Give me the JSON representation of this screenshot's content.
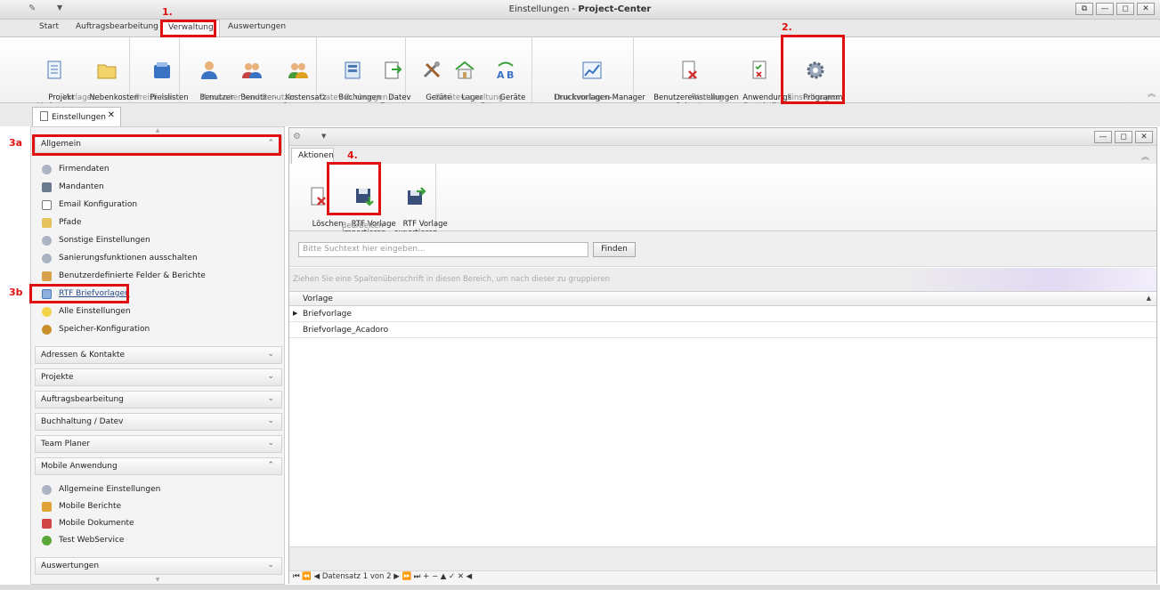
{
  "window": {
    "title_left": "Einstellungen - ",
    "title_bold": "Project-Center",
    "btn_restore": "⧉",
    "btn_minimize": "—",
    "btn_maximize": "◻",
    "btn_close": "✕"
  },
  "ribbon_tabs": [
    "Start",
    "Auftragsbearbeitung",
    "Verwaltung",
    "Auswertungen"
  ],
  "ribbon": {
    "buttons": {
      "projekt_vorlagen": "Projekt\nVorlagen",
      "nebenkosten": "Nebenkosten",
      "preislisten": "Preislisten",
      "benutzer": "Benutzer",
      "benutzergruppen": "Benutzer-\ngruppen",
      "kostensatz_gruppen": "Kostensatz\nGruppen",
      "buchungen": "Buchungen",
      "datev_export": "Datev\nExport",
      "geraete": "Geräte",
      "lager": "Lager",
      "geraete_bewegungen": "Geräte\nBewegungen",
      "druckvorlagen_manager": "Druckvorlagen-Manager",
      "benutzereinstellungen_zuruecksetzen": "Benutzereinstellungen\nzurücksetzen",
      "anwendungs_protokoll": "Anwendungs\nProtokoll",
      "programm_einstellungen": "Programm\nEinstellungen"
    },
    "groups": {
      "vorlagen": "Vorlagen",
      "preislisten": "Preislisten",
      "mandanten": "Mandanten und Benutzer",
      "datev": "Datev Buchungen / ...",
      "geraete": "Geräteverwaltung",
      "druck": "Druckvorlagen",
      "wartung": "Wartung",
      "einstellungen": "Einstellungen"
    }
  },
  "doc_tab": {
    "label": "Einstellungen",
    "close": "✕"
  },
  "sections": {
    "allgemein": "Allgemein",
    "adressen": "Adressen & Kontakte",
    "projekte": "Projekte",
    "auftrag": "Auftragsbearbeitung",
    "buchhaltung": "Buchhaltung / Datev",
    "team": "Team Planer",
    "mobile": "Mobile Anwendung",
    "auswertungen": "Auswertungen"
  },
  "allgemein_items": [
    "Firmendaten",
    "Mandanten",
    "Email Konfiguration",
    "Pfade",
    "Sonstige Einstellungen",
    "Sanierungsfunktionen ausschalten",
    "Benutzerdefinierte Felder & Berichte",
    "RTF Briefvorlagen",
    "Alle Einstellungen",
    "Speicher-Konfiguration"
  ],
  "mobile_items": [
    "Allgemeine Einstellungen",
    "Mobile Berichte",
    "Mobile Dokumente",
    "Test WebService"
  ],
  "inner": {
    "tab": "Aktionen",
    "buttons": {
      "loeschen": "Löschen",
      "import": "RTF Vorlage\nimportieren",
      "export": "RTF Vorlage\nexportieren"
    },
    "group": "Bearbeiten",
    "search_placeholder": "Bitte Suchtext hier eingeben...",
    "search_button": "Finden",
    "group_hint": "Ziehen Sie eine Spaltenüberschrift in diesen Bereich, um nach dieser zu gruppieren",
    "column": "Vorlage",
    "rows": [
      "Briefvorlage",
      "Briefvorlage_Acadoro"
    ],
    "navigator": "⏮ ⏪ ◀  Datensatz 1 von 2  ▶ ⏩ ⏭ + − ▲ ✓ ✕ ◀"
  },
  "annotations": {
    "a1": "1.",
    "a2": "2.",
    "a3a": "3a",
    "a3b": "3b",
    "a4": "4."
  },
  "colors": {
    "annotation_red": "#e01010",
    "accent_blue": "#2a6bc7"
  }
}
